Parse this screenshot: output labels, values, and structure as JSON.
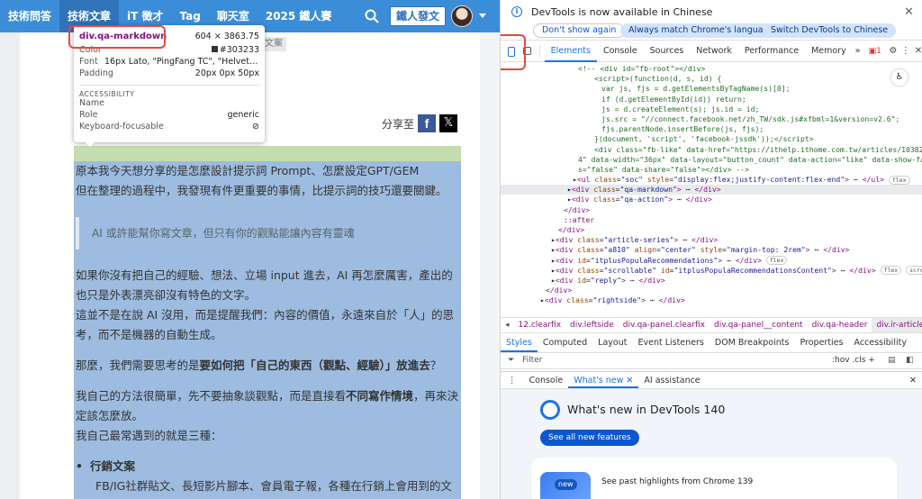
{
  "site": {
    "nav": [
      "技術問答",
      "技術文章",
      "iT 徵才",
      "Tag",
      "聊天室",
      "2025 鐵人賽"
    ],
    "post_button": "鐵人發文",
    "tag_chip": "文案",
    "share_label": "分享至",
    "fb": "f",
    "x": "𝕏"
  },
  "article": {
    "p1": "原本我今天想分享的是怎麼設計提示詞 Prompt、怎麼設定GPT/GEM",
    "p2": "但在整理的過程中，我發現有件更重要的事情，比提示詞的技巧還要關鍵。",
    "quote": "AI 或許能幫你寫文章，但只有你的觀點能讓內容有靈魂",
    "p3": "如果你沒有把自己的經驗、想法、立場 input 進去，AI 再怎麼厲害，產出的也只是外表漂亮卻沒有特色的文字。",
    "p4": "這並不是在說 AI 沒用，而是提醒我們：內容的價值，永遠來自於「人」的思考，而不是機器的自動生成。",
    "p5_a": "那麼，我們需要思考的是",
    "p5_b": "要如何把「自己的東西（觀點、經驗）」放進去",
    "p5_c": "？",
    "p6_a": "我自己的方法很簡單，先不要抽象談觀點，而是直接看",
    "p6_b": "不同寫作情境",
    "p6_c": "，再來決定該怎麼放。",
    "p7": "我自己最常遇到的就是三種：",
    "list1": "行銷文案",
    "list1_desc": "FB/IG社群貼文、長短影片腳本、會員電子報，各種在行銷上會用到的文"
  },
  "tooltip": {
    "selector": "div.qa-markdown",
    "size": "604 × 3863.75",
    "rows": [
      {
        "label": "Color",
        "value": "#303233"
      },
      {
        "label": "Font",
        "value": "16px Lato, \"PingFang TC\", \"Helvetica ..."
      },
      {
        "label": "Padding",
        "value": "20px 0px 50px"
      }
    ],
    "acc_header": "ACCESSIBILITY",
    "acc_rows": [
      {
        "label": "Name",
        "value": ""
      },
      {
        "label": "Role",
        "value": "generic"
      },
      {
        "label": "Keyboard-focusable",
        "value": "⊘"
      }
    ]
  },
  "devtools": {
    "info_message": "DevTools is now available in Chinese",
    "btn_dont": "Don't show again",
    "btn_match": "Always match Chrome's language",
    "btn_switch": "Switch DevTools to Chinese",
    "tabs": [
      "Elements",
      "Console",
      "Sources",
      "Network",
      "Performance",
      "Memory",
      "»"
    ],
    "error_count": "1",
    "breadcrumbs": [
      "12.clearfix",
      "div.leftside",
      "div.qa-panel.clearfix",
      "div.qa-panel__content",
      "div.qa-header",
      "div.ir-article-info"
    ],
    "style_tabs": [
      "Styles",
      "Computed",
      "Layout",
      "Event Listeners",
      "DOM Breakpoints",
      "Properties",
      "Accessibility"
    ],
    "filter_placeholder": "Filter",
    "filter_right": ":hov  .cls  +",
    "drawer_tabs": [
      "Console",
      "What's new ✕",
      "AI assistance"
    ],
    "whatsnew_title": "What's new in DevTools 140",
    "whatsnew_button": "See all new features",
    "whatsnew_card": "See past highlights from Chrome 139",
    "whatsnew_new": "new"
  },
  "colors": {
    "nav": "#3c8dd8",
    "highlight_content": "#9dbce0",
    "highlight_padding": "#c5dcae",
    "accent": "#1a73e8",
    "annotation": "#e04d3c"
  }
}
